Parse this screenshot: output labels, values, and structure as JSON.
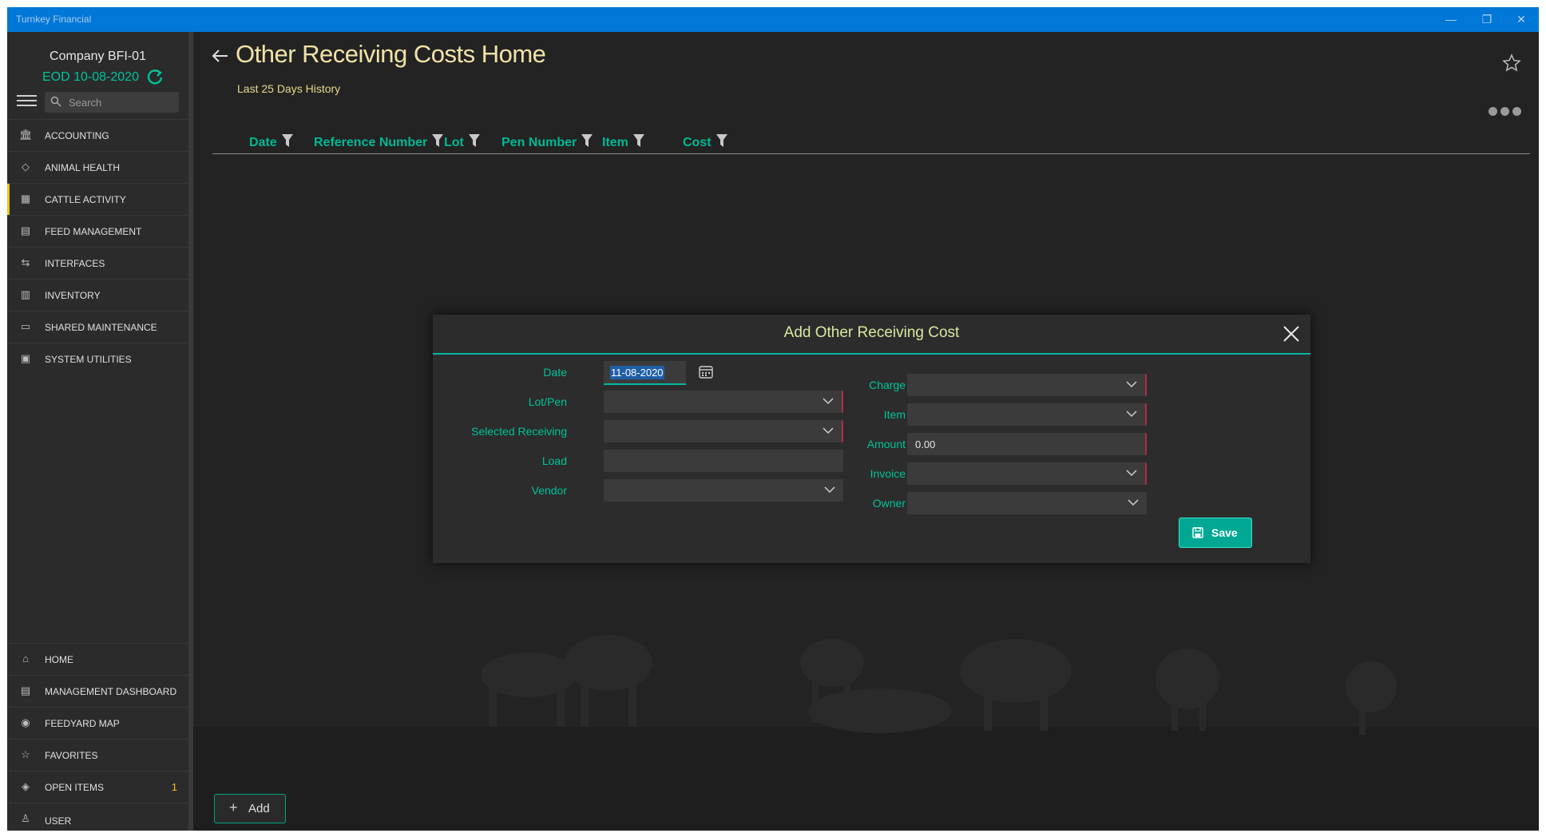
{
  "window": {
    "title": "Turnkey Financial",
    "minimize": "—",
    "restore": "❐",
    "close": "✕"
  },
  "sidebar": {
    "company": "Company BFI-01",
    "eod": "EOD 10-08-2020",
    "search_placeholder": "Search",
    "items": [
      {
        "label": "ACCOUNTING",
        "icon": "bank-icon",
        "glyph": "🏛"
      },
      {
        "label": "ANIMAL HEALTH",
        "icon": "tag-icon",
        "glyph": "◇"
      },
      {
        "label": "CATTLE ACTIVITY",
        "icon": "grid-icon",
        "glyph": "▦"
      },
      {
        "label": "FEED MANAGEMENT",
        "icon": "feed-icon",
        "glyph": "▤"
      },
      {
        "label": "INTERFACES",
        "icon": "interfaces-icon",
        "glyph": "⇆"
      },
      {
        "label": "INVENTORY",
        "icon": "inventory-icon",
        "glyph": "▥"
      },
      {
        "label": "SHARED MAINTENANCE",
        "icon": "folder-icon",
        "glyph": "▭"
      },
      {
        "label": "SYSTEM UTILITIES",
        "icon": "monitor-icon",
        "glyph": "▣"
      }
    ],
    "bottom_items": [
      {
        "label": "HOME",
        "icon": "home-icon",
        "glyph": "⌂"
      },
      {
        "label": "MANAGEMENT DASHBOARD",
        "icon": "dashboard-icon",
        "glyph": "▤"
      },
      {
        "label": "FEEDYARD MAP",
        "icon": "globe-icon",
        "glyph": "◉"
      },
      {
        "label": "FAVORITES",
        "icon": "star-icon",
        "glyph": "☆"
      },
      {
        "label": "OPEN ITEMS",
        "icon": "layers-icon",
        "glyph": "◈",
        "badge": "1"
      },
      {
        "label": "USER",
        "icon": "user-icon",
        "glyph": "♙"
      }
    ]
  },
  "main": {
    "title": "Other Receiving Costs Home",
    "subtitle": "Last 25 Days History",
    "columns": [
      "Date",
      "Reference Number",
      "Lot",
      "Pen Number",
      "Item",
      "Cost"
    ],
    "add_label": "Add"
  },
  "dialog": {
    "title": "Add Other Receiving Cost",
    "labels": {
      "date": "Date",
      "lot_pen": "Lot/Pen",
      "selected_receiving": "Selected Receiving",
      "load": "Load",
      "vendor": "Vendor",
      "charge": "Charge",
      "item": "Item",
      "amount": "Amount",
      "invoice": "Invoice",
      "owner": "Owner"
    },
    "values": {
      "date": "11-08-2020",
      "amount": "0.00"
    },
    "save_label": "Save"
  },
  "colors": {
    "accent": "#00c39a",
    "title": "#f1e3a8",
    "titlebar": "#0078d7",
    "required": "#b03040"
  }
}
